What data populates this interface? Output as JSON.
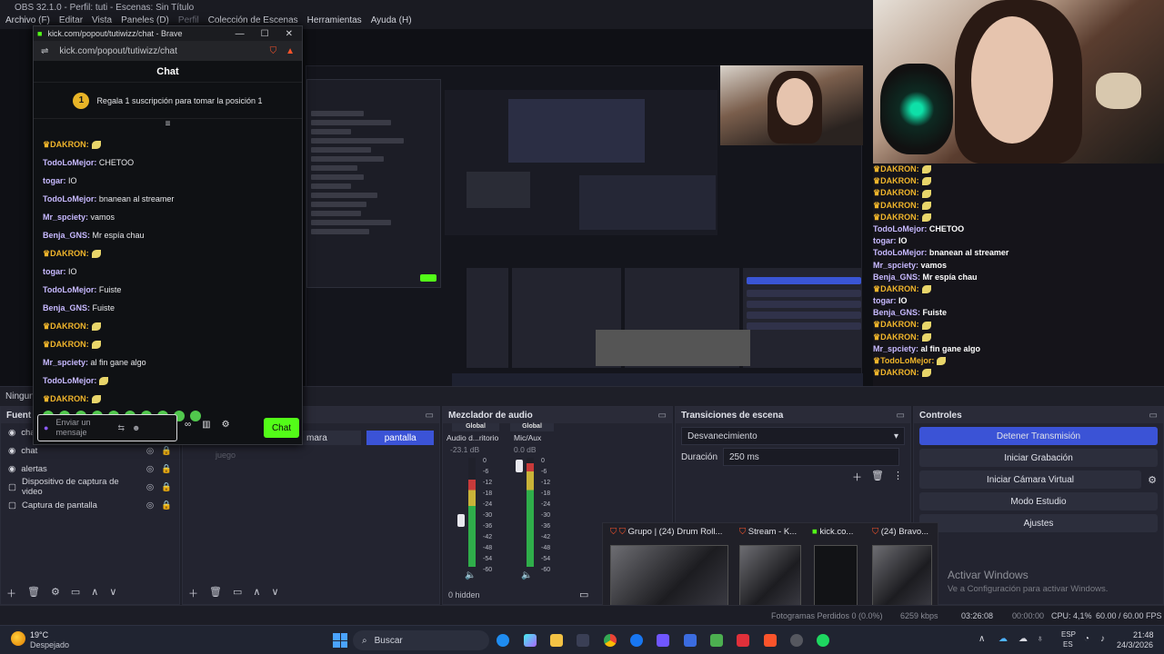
{
  "window_title": "OBS 32.1.0 - Perfil: tuti - Escenas: Sin Título",
  "menu": [
    "Archivo (F)",
    "Editar",
    "Vista",
    "Paneles (D)",
    "Perfil",
    "Colección de Escenas",
    "Herramientas",
    "Ayuda (H)"
  ],
  "popup": {
    "title": "kick.com/popout/tutiwizz/chat - Brave",
    "url": "kick.com/popout/tutiwizz/chat",
    "header": "Chat",
    "sub_goal_number": "1",
    "sub_goal": "Regala 1 suscripción para tomar la posición 1",
    "messages": [
      {
        "user": "DAKRON:",
        "text": "",
        "crown": true
      },
      {
        "user": "TodoLoMejor:",
        "text": "CHETOO",
        "crown": false
      },
      {
        "user": "togar:",
        "text": "IO",
        "crown": false
      },
      {
        "user": "TodoLoMejor:",
        "text": "bnanean al streamer",
        "crown": false
      },
      {
        "user": "Mr_spciety:",
        "text": "vamos",
        "crown": false
      },
      {
        "user": "Benja_GNS:",
        "text": "Mr espía chau",
        "crown": false
      },
      {
        "user": "DAKRON:",
        "text": "",
        "crown": true
      },
      {
        "user": "togar:",
        "text": "IO",
        "crown": false
      },
      {
        "user": "TodoLoMejor:",
        "text": "Fuiste",
        "crown": false
      },
      {
        "user": "Benja_GNS:",
        "text": "Fuiste",
        "crown": false
      },
      {
        "user": "DAKRON:",
        "text": "",
        "crown": true
      },
      {
        "user": "DAKRON:",
        "text": "",
        "crown": true
      },
      {
        "user": "Mr_spciety:",
        "text": "al fin gane algo",
        "crown": false
      },
      {
        "user": "TodoLoMejor:",
        "text": "",
        "crown": false
      },
      {
        "user": "DAKRON:",
        "text": "",
        "crown": true
      }
    ],
    "input_placeholder": "Enviar un mensaje",
    "chat_button": "Chat"
  },
  "overlay_chat": [
    {
      "user": "DAKRON:",
      "text": "",
      "crown": true
    },
    {
      "user": "DAKRON:",
      "text": "",
      "crown": true
    },
    {
      "user": "DAKRON:",
      "text": "",
      "crown": true
    },
    {
      "user": "DAKRON:",
      "text": "",
      "crown": true
    },
    {
      "user": "DAKRON:",
      "text": "",
      "crown": true
    },
    {
      "user": "TodoLoMejor:",
      "text": "CHETOO",
      "crown": false
    },
    {
      "user": "togar:",
      "text": "IO",
      "crown": false
    },
    {
      "user": "TodoLoMejor:",
      "text": "bnanean al streamer",
      "crown": false
    },
    {
      "user": "Mr_spciety:",
      "text": "vamos",
      "crown": false
    },
    {
      "user": "Benja_GNS:",
      "text": "Mr espía chau",
      "crown": false
    },
    {
      "user": "DAKRON:",
      "text": "",
      "crown": true
    },
    {
      "user": "togar:",
      "text": "IO",
      "crown": false
    },
    {
      "user": "Benja_GNS:",
      "text": "Fuiste",
      "crown": false
    },
    {
      "user": "DAKRON:",
      "text": "",
      "crown": true
    },
    {
      "user": "DAKRON:",
      "text": "",
      "crown": true
    },
    {
      "user": "Mr_spciety:",
      "text": "al fin gane algo",
      "crown": false
    },
    {
      "user": "TodoLoMejor:",
      "text": "",
      "crown": true
    },
    {
      "user": "DAKRON:",
      "text": "",
      "crown": true
    }
  ],
  "scene_strip": "Ningun",
  "sources": {
    "title": "Fuent",
    "items": [
      {
        "name": "cha",
        "icon": "eye-icon"
      },
      {
        "name": "chat",
        "icon": "eye-icon"
      },
      {
        "name": "alertas",
        "icon": "eye-icon"
      },
      {
        "name": "Dispositivo de captura de video",
        "icon": "eye-icon"
      },
      {
        "name": "Captura de pantalla",
        "icon": "eye-icon"
      }
    ]
  },
  "scenes": {
    "items": [
      "mara",
      "pantalla"
    ],
    "selected": "pantalla",
    "ghost": "juego"
  },
  "mixer": {
    "title": "Mezclador de audio",
    "channels": [
      {
        "group": "Global",
        "name": "Audio d...ritorio",
        "db": "-23.1 dB"
      },
      {
        "group": "Global",
        "name": "Mic/Aux",
        "db": "0.0 dB"
      }
    ],
    "ticks": [
      "0",
      "-6",
      "-12",
      "-18",
      "-24",
      "-30",
      "-36",
      "-42",
      "-48",
      "-54",
      "-60"
    ],
    "hidden": "0 hidden"
  },
  "transitions": {
    "title": "Transiciones de escena",
    "selected": "Desvanecimiento",
    "duration_label": "Duración",
    "duration_value": "250 ms"
  },
  "controls": {
    "title": "Controles",
    "buttons": [
      "Detener Transmisión",
      "Iniciar Grabación",
      "Iniciar Cámara Virtual",
      "Modo Estudio",
      "Ajustes"
    ]
  },
  "thumbs": [
    {
      "label": "Grupo | (24) Drum Roll..."
    },
    {
      "label": "Stream - K..."
    },
    {
      "label": "kick.co..."
    },
    {
      "label": "(24) Bravo..."
    }
  ],
  "activate": {
    "title": "Activar Windows",
    "subtitle": "Ve a Configuración para activar Windows."
  },
  "status": {
    "frames": "Fotogramas Perdidos 0 (0.0%)",
    "kbps": "6259 kbps",
    "live": "03:26:08",
    "rec": "00:00:00",
    "cpu": "CPU: 4,1%",
    "fps": "60.00 / 60.00 FPS"
  },
  "taskbar": {
    "weather_temp": "19°C",
    "weather_desc": "Despejado",
    "search": "Buscar",
    "lang1": "ESP",
    "lang2": "ES",
    "time": "21:48",
    "date": "24/3/2026"
  }
}
